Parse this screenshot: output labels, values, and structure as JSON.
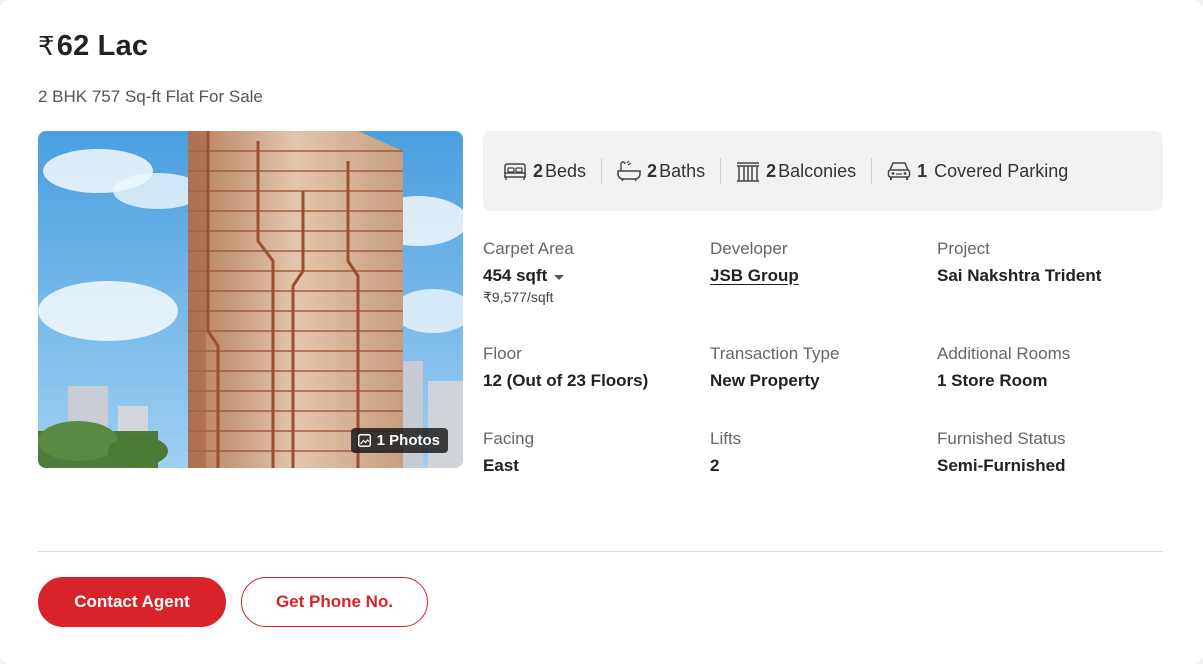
{
  "listing": {
    "currency_symbol": "₹",
    "price": "62 Lac",
    "title": "2 BHK 757 Sq-ft Flat For Sale",
    "photo_badge": "1 Photos"
  },
  "amenities": [
    {
      "icon": "bed-icon",
      "count": "2",
      "label": "Beds"
    },
    {
      "icon": "bathtub-icon",
      "count": "2",
      "label": "Baths"
    },
    {
      "icon": "balcony-icon",
      "count": "2",
      "label": "Balconies"
    },
    {
      "icon": "car-icon",
      "count": "1",
      "label": "Covered Parking"
    }
  ],
  "details": {
    "carpet_area": {
      "label": "Carpet Area",
      "value": "454 sqft",
      "per_sqft": "₹9,577/sqft"
    },
    "developer": {
      "label": "Developer",
      "value": "JSB Group"
    },
    "project": {
      "label": "Project",
      "value": "Sai Nakshtra Trident"
    },
    "floor": {
      "label": "Floor",
      "value": "12 (Out of 23 Floors)"
    },
    "transaction_type": {
      "label": "Transaction Type",
      "value": "New Property"
    },
    "additional_rooms": {
      "label": "Additional Rooms",
      "value": "1 Store Room"
    },
    "facing": {
      "label": "Facing",
      "value": "East"
    },
    "lifts": {
      "label": "Lifts",
      "value": "2"
    },
    "furnished_status": {
      "label": "Furnished Status",
      "value": "Semi-Furnished"
    }
  },
  "actions": {
    "contact_agent": "Contact Agent",
    "get_phone": "Get Phone No."
  },
  "colors": {
    "brand_red": "#d8232a",
    "text_dark": "#222222",
    "text_muted": "#666666"
  }
}
